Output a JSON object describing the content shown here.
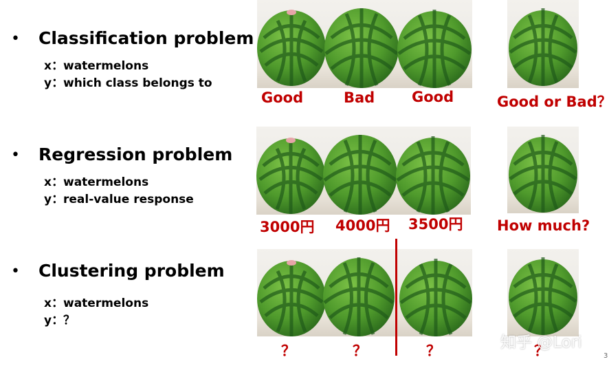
{
  "sections": [
    {
      "bullet": "•",
      "title": "Classification problem",
      "x_key": "x：",
      "x_value": "watermelons",
      "y_key": "y：",
      "y_value": "which class belongs to",
      "labels": [
        "Good",
        "Bad",
        "Good"
      ],
      "query": "Good or Bad？"
    },
    {
      "bullet": "•",
      "title": "Regression problem",
      "x_key": "x：",
      "x_value": "watermelons",
      "y_key": "y：",
      "y_value": "real-value response",
      "labels": [
        "3000円",
        "4000円",
        "3500円"
      ],
      "query": "How much?"
    },
    {
      "bullet": "•",
      "title": "Clustering problem",
      "x_key": "x：",
      "x_value": "watermelons",
      "y_key": "y：",
      "y_value": "？",
      "labels": [
        "？",
        "？",
        "？"
      ],
      "query": "？"
    }
  ],
  "watermark": "知乎 @Lori",
  "page_number": "3",
  "colors": {
    "label_red": "#c00000",
    "rind_dark": "#1f5a1a",
    "rind_light": "#6cae3a",
    "background": "#ffffff"
  },
  "icons": [
    "watermelon-image"
  ]
}
